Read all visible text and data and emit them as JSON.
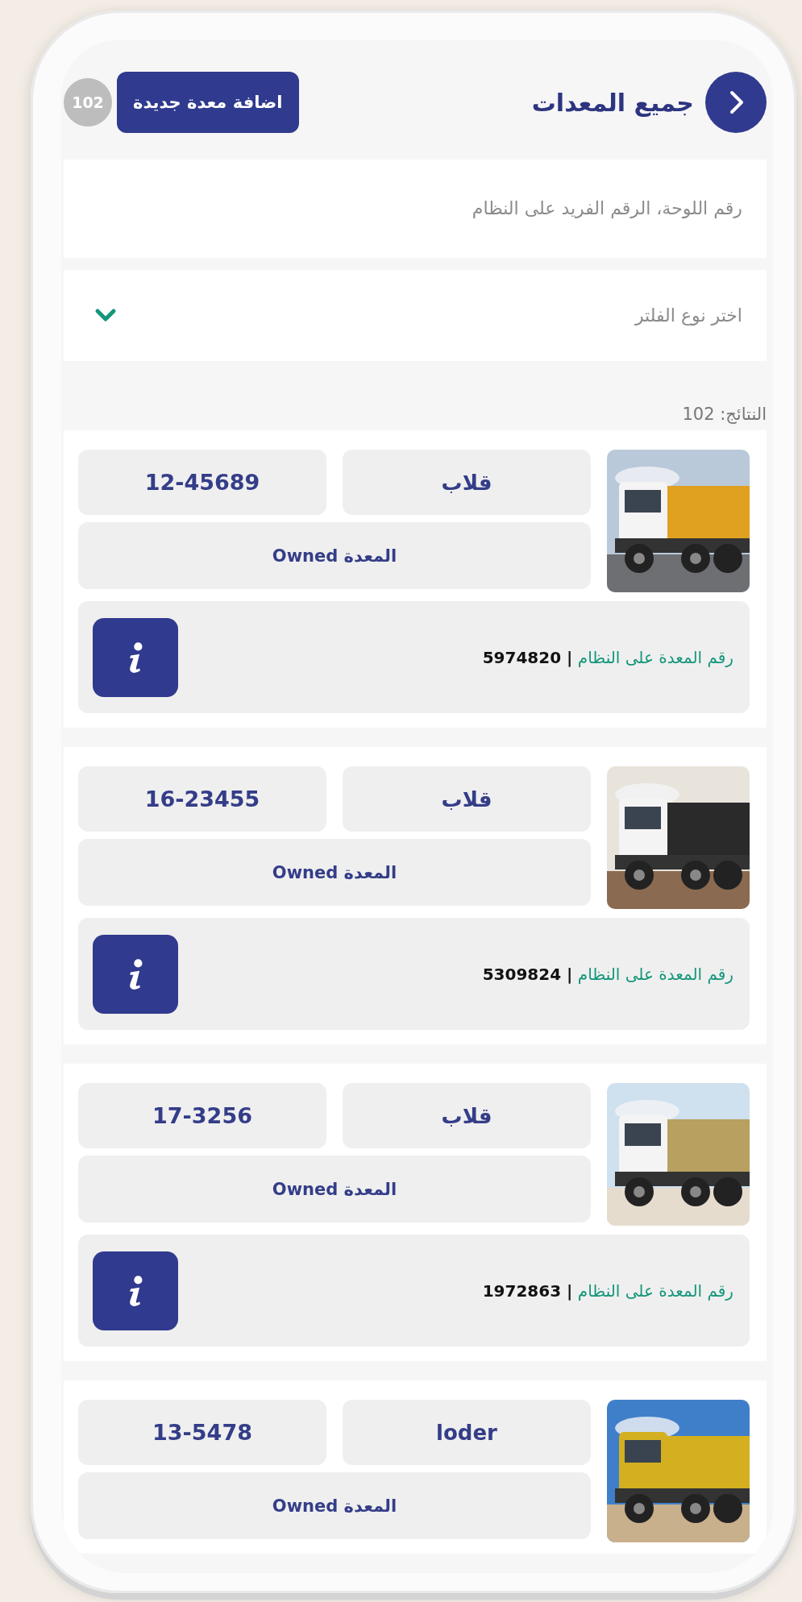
{
  "header": {
    "title": "جميع المعدات",
    "add_button": "اضافة معدة جديدة",
    "count_badge": "102"
  },
  "search": {
    "placeholder": "رقم اللوحة، الرقم الفريد على النظام"
  },
  "filter": {
    "placeholder": "اختر نوع الفلتر"
  },
  "results_label": "النتائج: 102",
  "equipment": [
    {
      "type": "قلاب",
      "plate": "12-45689",
      "ownership": "المعدة Owned",
      "system_number": "رقم المعدة على النظام **| 5974820**"
    },
    {
      "type": "قلاب",
      "plate": "16-23455",
      "ownership": "المعدة Owned",
      "system_number": "رقم المعدة على النظام **| 5309824**"
    },
    {
      "type": "قلاب",
      "plate": "17-3256",
      "ownership": "المعدة Owned",
      "system_number": "رقم المعدة على النظام **| 1972863**"
    },
    {
      "type": "loder",
      "plate": "13-5478",
      "ownership": "المعدة Owned"
    }
  ]
}
